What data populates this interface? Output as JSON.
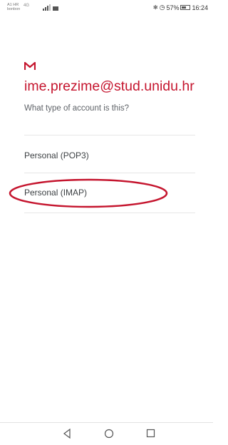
{
  "status_bar": {
    "carrier_line1": "A1 HR",
    "carrier_line2": "bonbon",
    "network_type": "4G",
    "battery_percent": "57%",
    "battery_level": 0.57,
    "time": "16:24"
  },
  "app": {
    "logo_icon": "gmail-m-icon",
    "brand_color": "#c5152e"
  },
  "main": {
    "email": "ime.prezime@stud.unidu.hr",
    "question": "What type of account is this?",
    "options": [
      {
        "label": "Personal (POP3)"
      },
      {
        "label": "Personal (IMAP)",
        "highlighted": true
      }
    ],
    "highlight_color": "#c5152e"
  },
  "nav_bar": {
    "buttons": [
      "back-icon",
      "home-icon",
      "recents-icon"
    ]
  }
}
